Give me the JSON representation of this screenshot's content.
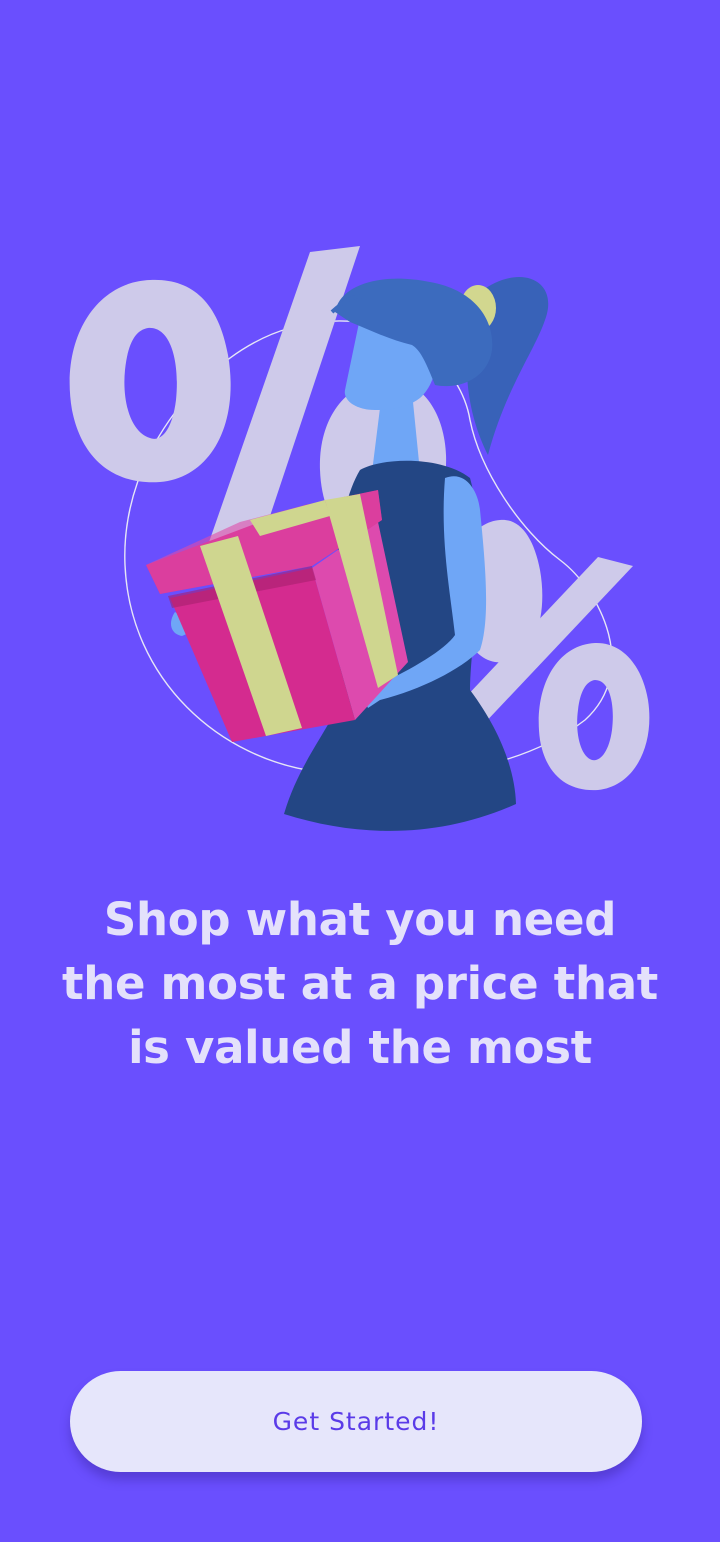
{
  "theme": {
    "background": "#6A4FFE",
    "headline_color": "#E4E1FB",
    "button_background": "#E6E6FB",
    "button_text_color": "#5A3BE8"
  },
  "illustration": {
    "icon": "woman-carrying-gift-box-with-percent-signs"
  },
  "onboarding": {
    "headline": "Shop what you need the most at a price that is valued the most",
    "cta_label": "Get Started!"
  }
}
